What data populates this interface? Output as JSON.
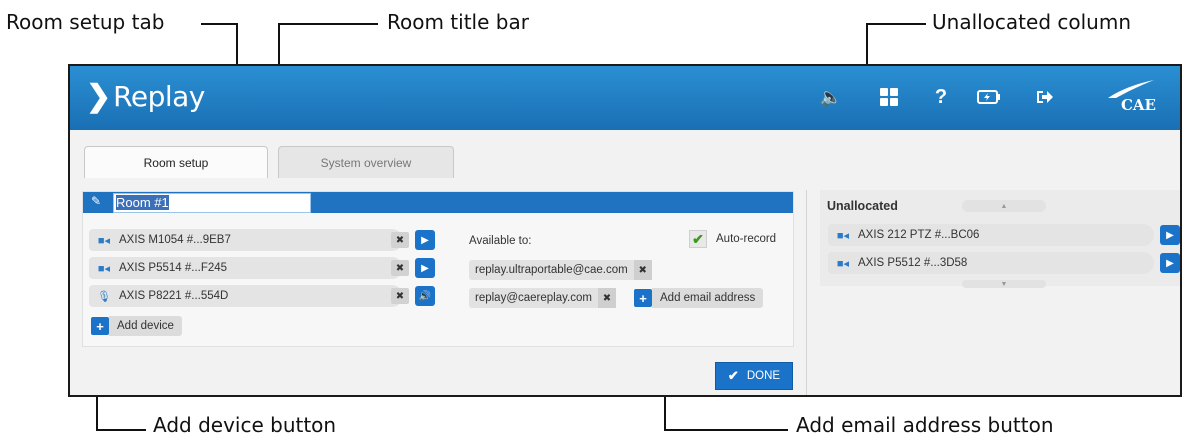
{
  "callouts": {
    "room_setup_tab": "Room setup tab",
    "room_title_bar": "Room title bar",
    "unallocated_column": "Unallocated column",
    "add_device_button": "Add device button",
    "add_email_button": "Add email address button"
  },
  "app": {
    "name": "Replay",
    "brand": "CAE",
    "header_icons": [
      "speaker-icon",
      "grid-icon",
      "help-icon",
      "battery-icon",
      "logout-icon"
    ],
    "accent_color": "#1a73c9"
  },
  "tabs": [
    {
      "label": "Room setup",
      "active": true
    },
    {
      "label": "System overview",
      "active": false
    }
  ],
  "room": {
    "title": "Room #1",
    "devices": [
      {
        "name": "AXIS M1054 #...9EB7",
        "icon": "camera-icon",
        "action_icon": "play-icon"
      },
      {
        "name": "AXIS P5514 #...F245",
        "icon": "camera-icon",
        "action_icon": "play-icon"
      },
      {
        "name": "AXIS P8221 #...554D",
        "icon": "microphone-icon",
        "action_icon": "volume-icon"
      }
    ],
    "add_device_label": "Add device",
    "available_to_label": "Available to:",
    "auto_record_label": "Auto-record",
    "auto_record_checked": true,
    "emails": [
      "replay.ultraportable@cae.com",
      "replay@caereplay.com"
    ],
    "add_email_label": "Add email address",
    "done_label": "DONE"
  },
  "unallocated": {
    "title": "Unallocated",
    "devices": [
      {
        "name": "AXIS 212 PTZ #...BC06",
        "icon": "camera-icon"
      },
      {
        "name": "AXIS P5512 #...3D58",
        "icon": "camera-icon"
      }
    ]
  }
}
